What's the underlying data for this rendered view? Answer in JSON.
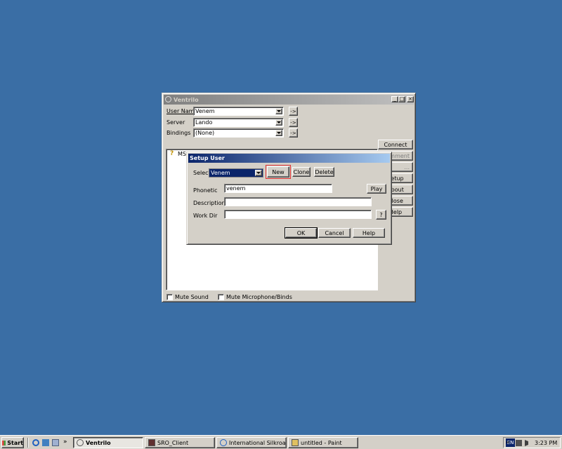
{
  "ventrilo": {
    "title": "Ventrilo",
    "user_name_label": "User Name",
    "user_name_value": "Venem",
    "server_label": "Server",
    "server_value": "Lando",
    "bindings_label": "Bindings",
    "bindings_value": "(None)",
    "arrow_label": "->",
    "connect_label": "Connect",
    "comment_label": "mment",
    "user_label": "...",
    "setup_label": "Setup",
    "about_label": "About",
    "close_label": "Close",
    "help_label": "Help",
    "tree_item": "MSC",
    "mute_sound_label": "Mute Sound",
    "mute_mic_label": "Mute Microphone/Binds"
  },
  "setup": {
    "title": "Setup User",
    "select_label": "Select",
    "select_value": "Venem",
    "new_label": "New",
    "clone_label": "Clone",
    "delete_label": "Delete",
    "phonetic_label": "Phonetic",
    "phonetic_value": "venem",
    "play_label": "Play",
    "description_label": "Description",
    "description_value": "",
    "workdir_label": "Work Dir",
    "workdir_value": "",
    "browse_label": "?",
    "ok_label": "OK",
    "cancel_label": "Cancel",
    "help_label": "Help"
  },
  "taskbar": {
    "start_label": "Start",
    "quick_more": "»",
    "tasks": [
      "Ventrilo",
      "SRO_Client",
      "International Silkroad Fo...",
      "untitled - Paint"
    ],
    "lang": "EN",
    "tray_more": "«",
    "clock": "3:23 PM"
  },
  "colors": {
    "desktop": "#3a6ea5",
    "active_title": "#0a246a",
    "inactive_title": "#808080",
    "highlight": "#0a246a",
    "new_button_outline": "#e03030"
  }
}
